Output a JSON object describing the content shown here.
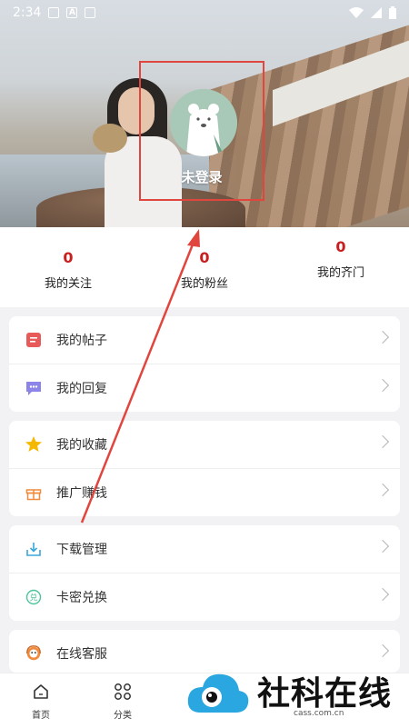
{
  "status_bar": {
    "time": "2:34",
    "notif_a": "A"
  },
  "profile": {
    "login_label": "未登录"
  },
  "stats": [
    {
      "value": "0",
      "label": "我的关注"
    },
    {
      "value": "0",
      "label": "我的粉丝"
    },
    {
      "value": "0",
      "label": "我的齐门"
    }
  ],
  "menu_groups": [
    [
      {
        "label": "我的帖子",
        "icon": "post-icon",
        "color": "#e85a5a"
      },
      {
        "label": "我的回复",
        "icon": "reply-icon",
        "color": "#8c84e8"
      }
    ],
    [
      {
        "label": "我的收藏",
        "icon": "star-icon",
        "color": "#f5b800"
      },
      {
        "label": "推广赚钱",
        "icon": "gift-icon",
        "color": "#f08a3c"
      }
    ],
    [
      {
        "label": "下载管理",
        "icon": "download-icon",
        "color": "#3aa7d8"
      },
      {
        "label": "卡密兑换",
        "icon": "exchange-icon",
        "color": "#4cc39a"
      }
    ],
    [
      {
        "label": "在线客服",
        "icon": "service-icon",
        "color": "#f08a3c"
      }
    ]
  ],
  "bottom_nav": [
    {
      "label": "首页",
      "icon": "home-icon"
    },
    {
      "label": "分类",
      "icon": "category-icon"
    }
  ],
  "watermark": {
    "text": "社科在线",
    "sub": "cass.com.cn"
  }
}
